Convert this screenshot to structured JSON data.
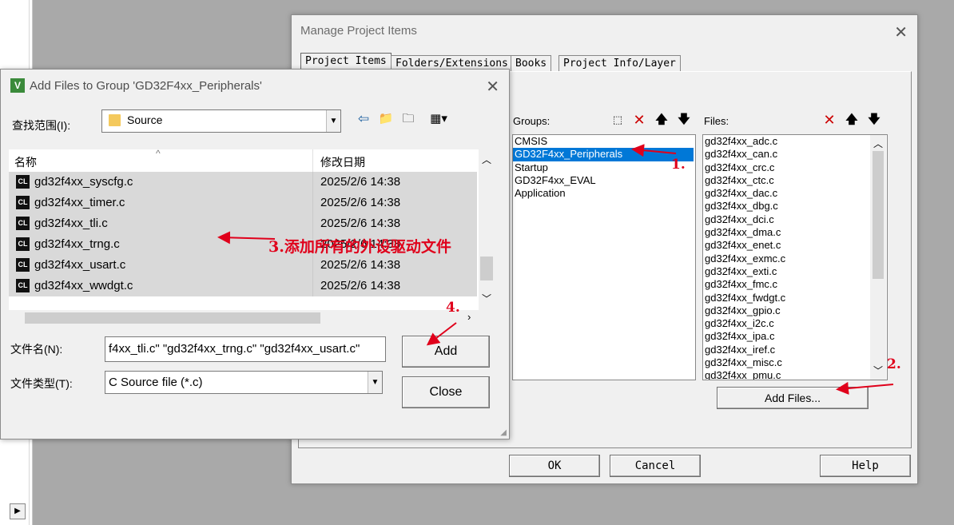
{
  "manage": {
    "title": "Manage Project Items",
    "tabs": [
      "Project Items",
      "Folders/Extensions",
      "Books",
      "Project Info/Layer"
    ],
    "groups_label": "Groups:",
    "files_label": "Files:",
    "groups": [
      "CMSIS",
      "GD32F4xx_Peripherals",
      "Startup",
      "GD32F4xx_EVAL",
      "Application"
    ],
    "selected_group": 1,
    "files": [
      "gd32f4xx_adc.c",
      "gd32f4xx_can.c",
      "gd32f4xx_crc.c",
      "gd32f4xx_ctc.c",
      "gd32f4xx_dac.c",
      "gd32f4xx_dbg.c",
      "gd32f4xx_dci.c",
      "gd32f4xx_dma.c",
      "gd32f4xx_enet.c",
      "gd32f4xx_exmc.c",
      "gd32f4xx_exti.c",
      "gd32f4xx_fmc.c",
      "gd32f4xx_fwdgt.c",
      "gd32f4xx_gpio.c",
      "gd32f4xx_i2c.c",
      "gd32f4xx_ipa.c",
      "gd32f4xx_iref.c",
      "gd32f4xx_misc.c",
      "gd32f4xx_pmu.c"
    ],
    "add_files_button": "Add Files...",
    "ok_button": "OK",
    "cancel_button": "Cancel",
    "help_button": "Help"
  },
  "add": {
    "title": "Add Files to Group 'GD32F4xx_Peripherals'",
    "look_in_label": "查找范围(I):",
    "look_in_value": "Source",
    "col_name": "名称",
    "col_date": "修改日期",
    "files": [
      {
        "name": "gd32f4xx_syscfg.c",
        "date": "2025/2/6 14:38"
      },
      {
        "name": "gd32f4xx_timer.c",
        "date": "2025/2/6 14:38"
      },
      {
        "name": "gd32f4xx_tli.c",
        "date": "2025/2/6 14:38"
      },
      {
        "name": "gd32f4xx_trng.c",
        "date": "2025/2/6 14:38"
      },
      {
        "name": "gd32f4xx_usart.c",
        "date": "2025/2/6 14:38"
      },
      {
        "name": "gd32f4xx_wwdgt.c",
        "date": "2025/2/6 14:38"
      }
    ],
    "file_icon_text": "CL",
    "filename_label": "文件名(N):",
    "filename_value": "f4xx_tli.c\" \"gd32f4xx_trng.c\" \"gd32f4xx_usart.c\"",
    "filetype_label": "文件类型(T):",
    "filetype_value": "C Source file (*.c)",
    "add_button": "Add",
    "close_button": "Close"
  },
  "annotations": {
    "a1": "1.",
    "a2": "2.",
    "a3": "3.添加所有的外设驱动文件",
    "a4": "4.",
    "color": "#e0001b"
  }
}
